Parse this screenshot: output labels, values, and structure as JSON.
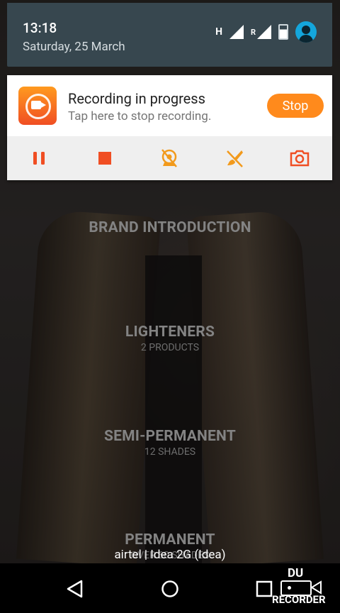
{
  "status": {
    "time": "13:18",
    "date": "Saturday, 25 March",
    "network_label": "H",
    "roaming_label": "R"
  },
  "notification": {
    "title": "Recording in progress",
    "subtitle": "Tap here to stop recording.",
    "stop_label": "Stop",
    "accent_color": "#ff8a1c",
    "action_color": "#f04e23",
    "actions": [
      "pause-icon",
      "stop-icon",
      "camera-off-icon",
      "brush-off-icon",
      "screenshot-icon"
    ]
  },
  "menu": [
    {
      "title": "BRAND INTRODUCTION",
      "sub": ""
    },
    {
      "title": "LIGHTENERS",
      "sub": "2 PRODUCTS"
    },
    {
      "title": "SEMI-PERMANENT",
      "sub": "12 SHADES"
    },
    {
      "title": "PERMANENT",
      "sub": "OVER 60 SHADES"
    }
  ],
  "carrier": "airtel | Idea 2G (Idea)",
  "watermark": {
    "line1": "DU",
    "line2": "RECORDER"
  }
}
